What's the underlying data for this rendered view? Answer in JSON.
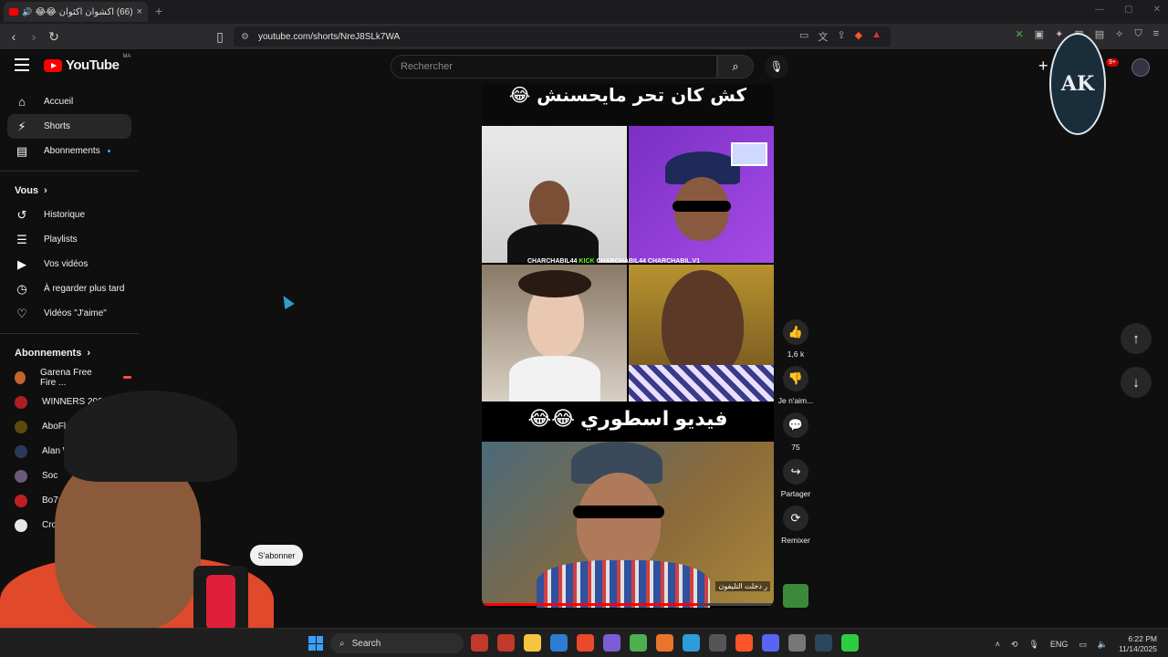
{
  "browser": {
    "tab_title": "(66) اكشوان اكثوان 😂😂 - be",
    "tab_close": "×",
    "new_tab": "+",
    "url": "youtube.com/shorts/NreJ8SLk7WA",
    "window_controls": [
      "—",
      "▢",
      "✕"
    ]
  },
  "youtube": {
    "logo_text": "YouTube",
    "country_code": "MA",
    "search_placeholder": "Rechercher",
    "notifications_badge": "9+",
    "sidebar": {
      "main": [
        {
          "label": "Accueil",
          "icon": "home-icon",
          "glyph": "⌂"
        },
        {
          "label": "Shorts",
          "icon": "shorts-icon",
          "glyph": "⚡"
        },
        {
          "label": "Abonnements",
          "icon": "subscriptions-icon",
          "glyph": "▤"
        }
      ],
      "you_header": "Vous",
      "you": [
        {
          "label": "Historique",
          "icon": "history-icon",
          "glyph": "↺"
        },
        {
          "label": "Playlists",
          "icon": "playlists-icon",
          "glyph": "☰"
        },
        {
          "label": "Vos vidéos",
          "icon": "your-videos-icon",
          "glyph": "▶"
        },
        {
          "label": "À regarder plus tard",
          "icon": "watch-later-icon",
          "glyph": "◷"
        },
        {
          "label": "Vidéos \"J'aime\"",
          "icon": "liked-icon",
          "glyph": "👍"
        }
      ],
      "subs_header": "Abonnements",
      "subscriptions": [
        {
          "label": "Garena Free Fire ...",
          "color": "#c0652b",
          "live": true
        },
        {
          "label": "WINNERS 2005",
          "color": "#b01e23",
          "live": false
        },
        {
          "label": "AboFlah",
          "color": "#5a4a10",
          "live": false
        },
        {
          "label": "Alan W",
          "color": "#2a3a5a",
          "live": false
        },
        {
          "label": "Soc",
          "color": "#6a5a7a",
          "live": false
        },
        {
          "label": "Bo7a",
          "color": "#c02020",
          "live": false
        },
        {
          "label": "Cro",
          "color": "#e8e8e8",
          "live": false
        }
      ]
    },
    "short": {
      "banner_text": "كش كان تحر مايحسنش 😂",
      "handles_pre": "CHARCHABIL44",
      "handles_kick": "KICK",
      "handles_mid": "CHARCHABIL44",
      "handles_post": "CHARCHABIL.V1",
      "mid_text": "فيديو اسطوري 😂😂",
      "caption": "ر دخلت التليفون",
      "progress_fraction": 0.74
    },
    "actions": [
      {
        "name": "like-button",
        "icon": "thumbs-up-icon",
        "glyph": "👍",
        "label": "1,6 k"
      },
      {
        "name": "dislike-button",
        "icon": "thumbs-down-icon",
        "glyph": "👎",
        "label": "Je n'aim..."
      },
      {
        "name": "comments-button",
        "icon": "comment-icon",
        "glyph": "💬",
        "label": "75"
      },
      {
        "name": "share-button",
        "icon": "share-icon",
        "glyph": "↪",
        "label": "Partager"
      },
      {
        "name": "remix-button",
        "icon": "remix-icon",
        "glyph": "⟳",
        "label": "Remixer"
      }
    ],
    "subscribe_label": "S'abonner",
    "nav_up": "↑",
    "nav_down": "↓"
  },
  "taskbar": {
    "search_label": "Search",
    "language": "ENG",
    "time": "6:22 PM",
    "date": "11/14/2025",
    "app_colors": [
      "#c0392b",
      "#c0392b",
      "#f5c542",
      "#2d7dd2",
      "#e84a2b",
      "#7b5cd6",
      "#4caf50",
      "#e8752a",
      "#2d9cdb",
      "#555555",
      "#fb542b",
      "#5865f2",
      "#777777",
      "#2a475e",
      "#2ecc40"
    ]
  }
}
